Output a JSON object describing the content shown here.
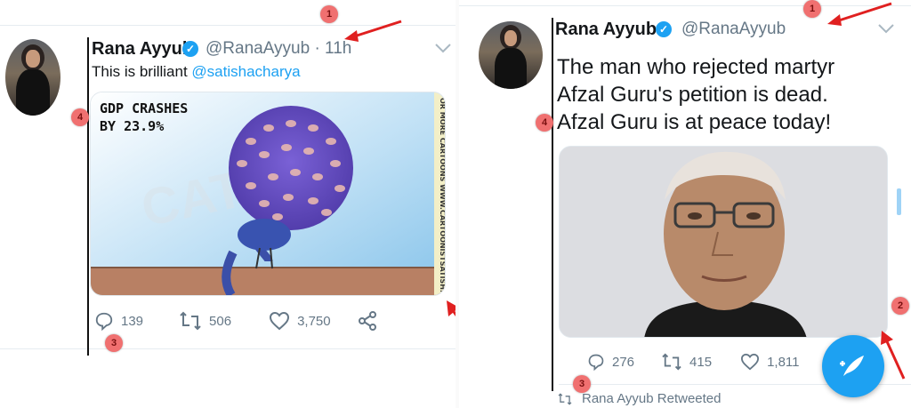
{
  "colors": {
    "accent": "#1da1f2",
    "annotation": "#e02020",
    "badge": "#f07070",
    "text_secondary": "#657786"
  },
  "left_tweet": {
    "author_name": "Rana Ayyub",
    "handle_time": "@RanaAyyub · 11h",
    "text_plain": "This is brilliant ",
    "text_mention": "@satishacharya",
    "cartoon": {
      "headline_line1": "GDP CRASHES",
      "headline_line2": "BY 23.9%",
      "side_text": "OR MORE CARTOONS WWW.CARTOONISTSATISH."
    },
    "replies": "139",
    "retweets": "506",
    "likes": "3,750"
  },
  "right_tweet": {
    "author_name": "Rana Ayyub",
    "handle": "@RanaAyyub",
    "text_line1": "The man who rejected martyr",
    "text_line2": "Afzal Guru's petition is dead.",
    "text_line3": "Afzal Guru is at peace today!",
    "replies": "276",
    "retweets": "415",
    "likes": "1,811",
    "retweeted_label": "Rana Ayyub Retweeted"
  },
  "annotations": {
    "b1": "1",
    "b2": "2",
    "b3": "3",
    "b4": "4"
  },
  "icons": [
    "verified-icon",
    "chevron-down-icon",
    "reply-icon",
    "retweet-icon",
    "like-icon",
    "share-icon",
    "compose-icon",
    "arrow-icon"
  ]
}
